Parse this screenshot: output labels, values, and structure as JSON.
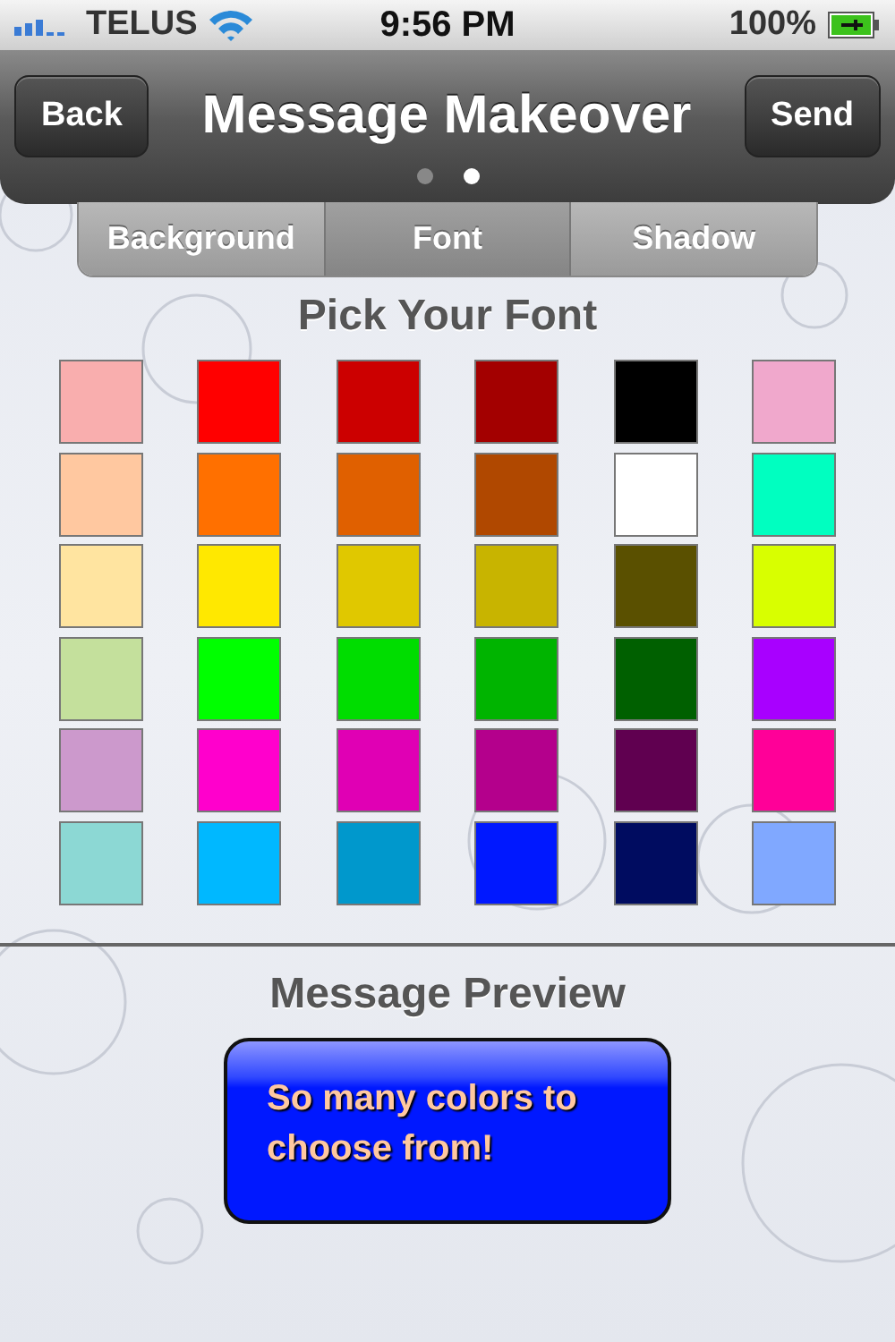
{
  "status_bar": {
    "carrier": "TELUS",
    "time": "9:56 PM",
    "battery": "100%"
  },
  "nav_bar": {
    "back": "Back",
    "title": "Message Makeover",
    "action": "Send"
  },
  "page_dots": [
    {
      "selected": false
    },
    {
      "selected": true
    }
  ],
  "tabs": [
    {
      "label": "Background",
      "selected": false
    },
    {
      "label": "Font",
      "selected": true
    },
    {
      "label": "Shadow",
      "selected": false
    }
  ],
  "palette": {
    "title": "Pick Your Font",
    "rows": [
      [
        {
          "color": "#f9aeae"
        },
        {
          "color": "#ff0000"
        },
        {
          "color": "#cc0000"
        },
        {
          "color": "#a30000"
        },
        {
          "color": "#000000"
        },
        {
          "color": "#f0a8cc"
        }
      ],
      [
        {
          "color": "#ffc8a0"
        },
        {
          "color": "#ff7000"
        },
        {
          "color": "#e06000"
        },
        {
          "color": "#b04800"
        },
        {
          "color": "#ffffff"
        },
        {
          "color": "#00ffc0"
        }
      ],
      [
        {
          "color": "#ffe4a0"
        },
        {
          "color": "#ffe800"
        },
        {
          "color": "#e0c800"
        },
        {
          "color": "#c8b400"
        },
        {
          "color": "#5a5000"
        },
        {
          "color": "#d8ff00"
        }
      ],
      [
        {
          "color": "#c4e09c"
        },
        {
          "color": "#00ff00"
        },
        {
          "color": "#00dd00"
        },
        {
          "color": "#00b400"
        },
        {
          "color": "#006000"
        },
        {
          "color": "#a800ff"
        }
      ],
      [
        {
          "color": "#cc99cc"
        },
        {
          "color": "#ff00cc"
        },
        {
          "color": "#e000b4"
        },
        {
          "color": "#b4008c"
        },
        {
          "color": "#600050"
        },
        {
          "color": "#ff0098"
        }
      ],
      [
        {
          "color": "#8cd8d4"
        },
        {
          "color": "#00b8ff"
        },
        {
          "color": "#0098cc"
        },
        {
          "color": "#0018ff"
        },
        {
          "color": "#000c60"
        },
        {
          "color": "#80a8ff"
        }
      ]
    ]
  },
  "preview": {
    "title": "Message Preview",
    "message": "So many colors to choose from!"
  }
}
